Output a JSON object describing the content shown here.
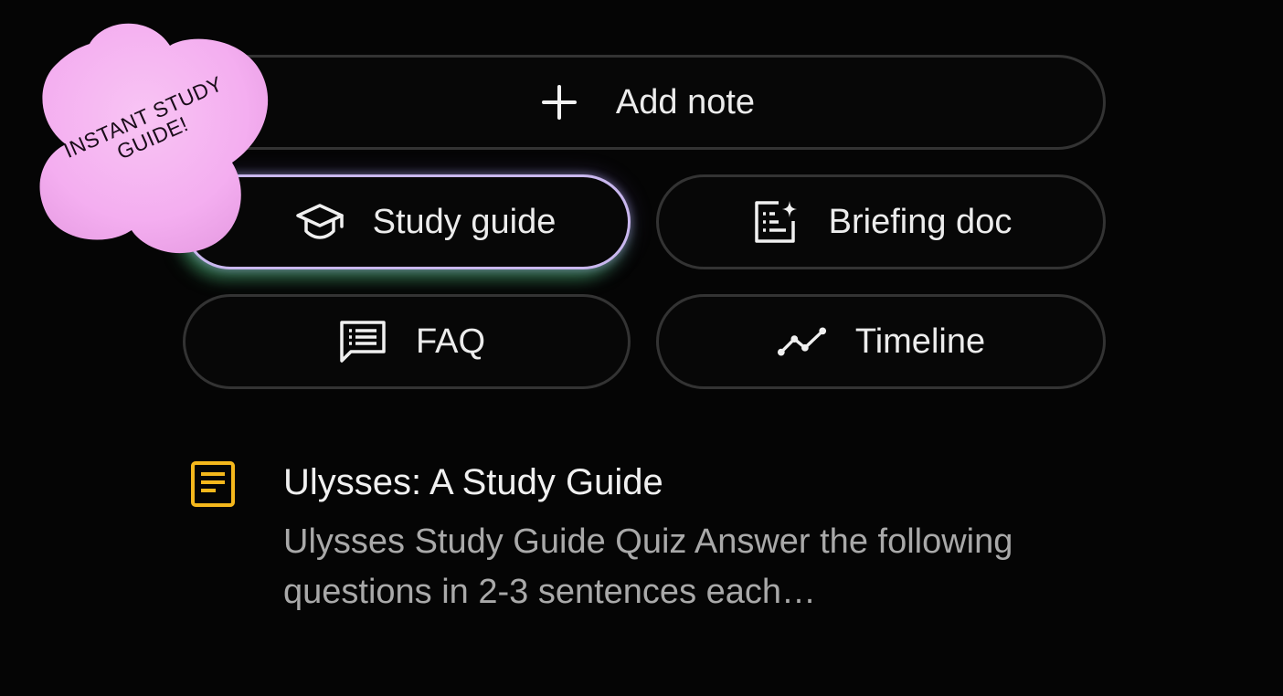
{
  "sticker": {
    "text": "INSTANT STUDY GUIDE!",
    "color": "#f6b3f0"
  },
  "actions": {
    "add_note": {
      "label": "Add note",
      "icon": "plus-icon"
    },
    "study_guide": {
      "label": "Study guide",
      "icon": "graduation-cap-icon",
      "highlight_color": "#c9b7ee"
    },
    "briefing_doc": {
      "label": "Briefing doc",
      "icon": "sparkle-document-icon"
    },
    "faq": {
      "label": "FAQ",
      "icon": "chat-list-icon"
    },
    "timeline": {
      "label": "Timeline",
      "icon": "trend-line-icon"
    }
  },
  "note": {
    "icon": "document-icon",
    "icon_color": "#f5b81c",
    "title": "Ulysses: A Study Guide",
    "snippet": "Ulysses Study Guide Quiz Answer the following questions in 2-3 sentences each…"
  }
}
